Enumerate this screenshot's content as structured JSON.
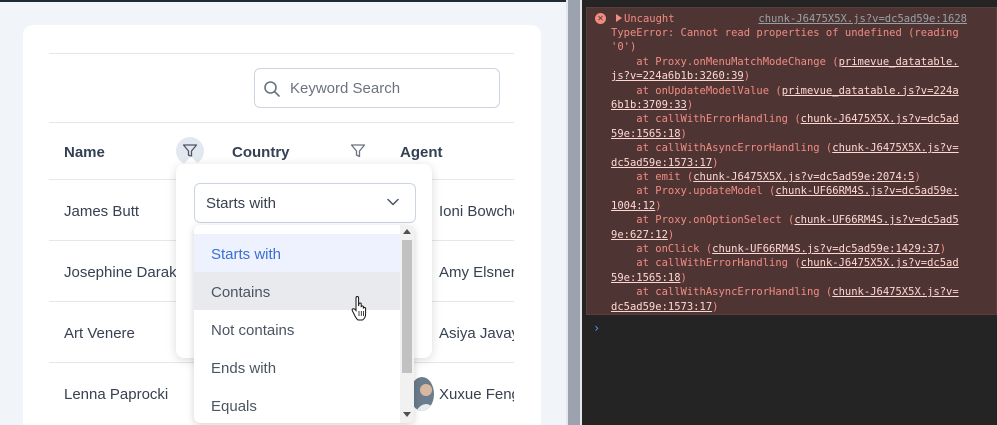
{
  "search": {
    "placeholder": "Keyword Search"
  },
  "columns": [
    {
      "label": "Name",
      "filter_active": true
    },
    {
      "label": "Country",
      "filter_active": false
    },
    {
      "label": "Agent"
    }
  ],
  "rows": [
    {
      "name": "James Butt",
      "agent": "Ioni Bowcher"
    },
    {
      "name": "Josephine Darakjy",
      "agent": "Amy Elsner"
    },
    {
      "name": "Art Venere",
      "agent": "Asiya Javayant"
    },
    {
      "name": "Lenna Paprocki",
      "agent": "Xuxue Feng"
    }
  ],
  "filter": {
    "selected": "Starts with",
    "options": [
      "Starts with",
      "Contains",
      "Not contains",
      "Ends with",
      "Equals"
    ],
    "hovered_index": 1
  },
  "console": {
    "source": "chunk-J6475X5X.js?v=dc5ad59e:1628",
    "error_title": "Uncaught",
    "message_lines": [
      "TypeError: Cannot read properties of undefined (reading",
      "'0')"
    ],
    "stack": [
      {
        "pre": "    at Proxy.onMenuMatchModeChange (",
        "link1": "primevue_datatable.",
        "link2": "js?v=224a6b1b:3260:39",
        "post": ")"
      },
      {
        "pre": "    at onUpdateModelValue (",
        "link1": "primevue_datatable.js?v=224a",
        "link2": "6b1b:3709:33",
        "post": ")"
      },
      {
        "pre": "    at callWithErrorHandling (",
        "link1": "chunk-J6475X5X.js?v=dc5ad",
        "link2": "59e:1565:18",
        "post": ")"
      },
      {
        "pre": "    at callWithAsyncErrorHandling (",
        "link1": "chunk-J6475X5X.js?v=",
        "link2": "dc5ad59e:1573:17",
        "post": ")"
      },
      {
        "pre": "    at emit (",
        "link1": "chunk-J6475X5X.js?v=dc5ad59e:2074:5",
        "link2": "",
        "post": ")"
      },
      {
        "pre": "    at Proxy.updateModel (",
        "link1": "chunk-UF66RM4S.js?v=dc5ad59e:",
        "link2": "1004:12",
        "post": ")"
      },
      {
        "pre": "    at Proxy.onOptionSelect (",
        "link1": "chunk-UF66RM4S.js?v=dc5ad5",
        "link2": "9e:627:12",
        "post": ")"
      },
      {
        "pre": "    at onClick (",
        "link1": "chunk-UF66RM4S.js?v=dc5ad59e:1429:37",
        "link2": "",
        "post": ")"
      },
      {
        "pre": "    at callWithErrorHandling (",
        "link1": "chunk-J6475X5X.js?v=dc5ad",
        "link2": "59e:1565:18",
        "post": ")"
      },
      {
        "pre": "    at callWithAsyncErrorHandling (",
        "link1": "chunk-J6475X5X.js?v=",
        "link2": "dc5ad59e:1573:17",
        "post": ")"
      }
    ],
    "prompt": "›"
  },
  "colors": {
    "accent": "#3b6fd1",
    "error_text": "#f28b82",
    "error_bg": "#4e3534",
    "console_bg": "#242424"
  }
}
